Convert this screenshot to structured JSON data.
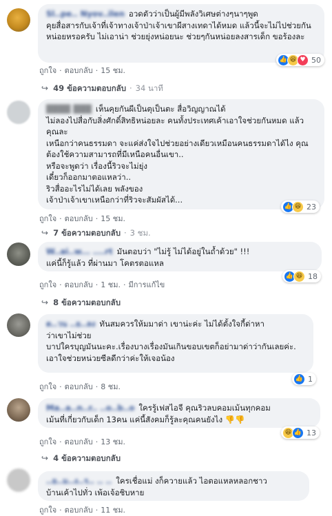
{
  "actions": {
    "like": "ถูกใจ",
    "reply": "ตอบกลับ",
    "sep": "·"
  },
  "comments": [
    {
      "author": "Sl..pe.. Nyov..ilen",
      "text_line1": "อวดตัวว่าเป็นผู้มีพลังวิเศษต่างๆนาๆพูด",
      "text_rest": "คุยสื่อสารกับเจ้าที่เจ้าทางเจ้าป่าเจ้าเขาผีสางเทดาได้หมด แล้วนี้จะไม่ไปช่วยกันหน่อยหรอครับ ไม่เอาน่า ช่วยยุ่งหน่อยนะ ช่วยๆกันหน่อยลงสารเด็ก ขอร้องละ",
      "time": "15 ชม.",
      "reaction_count": "50",
      "replies_count": "49 ข้อความตอบกลับ",
      "replies_time": "34 นาที"
    },
    {
      "author": "████ ███",
      "text_line1": "เห็นคุยกันผีเป็นตุเป็นตะ สื่อวิญญาณได้",
      "text_rest": "ไม่ลองไปสื่อกับสิ่งศักดิ์สิทธิหน่อยละ คนทั้งประเทศเค้าเอาใจช่วยกันหมด แล้วคุณละ\nเหนือกว่าคนธรรมดา จะแค่ส่งใจไปช่วยอย่างเดียวเหมือนคนธรรมดาได้ไง คุณต้องใช้ความสามารถที่มีเหนือคนอื่นเขา..\nหรือจะพูดว่า เรื่องนี้ริวจะไม่ยุ่ง\nเดี๋ยวก็ออกมาตอแหลว่า..\nริวสื่ออะไรไม่ได้เลย พลังของ\nเจ้าป่าเจ้าเขาเหนือกว่าที่ริวจะสัมผัสได้...",
      "time": "15 ชม.",
      "reaction_count": "23",
      "replies_count": "7 ข้อความตอบกลับ",
      "replies_time": "3 ชม."
    },
    {
      "author": "W..ai..w... ....rt",
      "text_line1": "มันตอบว่า \"ไม่รู้ ไม่ได้อยู่ในถ้ำด้วย\" !!!",
      "text_rest": "แค่นี้ก็รู้แล้ว ที่ผ่านมา โคตรตอแหล",
      "time": "1 ชม.",
      "edited": "มีการแก้ไข",
      "reaction_count": "18",
      "replies_count": "8 ข้อความตอบกลับ",
      "replies_time": ""
    },
    {
      "author": "ต..วน ..ย..ลง",
      "text_line1": "ทันสมควรให้มมาด่า เขาน่ะค่ะ ไม่ได้ตั้งใจกี้ด่าหา",
      "text_rest": "ว่าเขาไม่ช่วย\nบาปใครบุญมันนะคะ.เรื่องบางเรื่องมันเกินขอบเขตก็อย่ามาด่าว่ากันเลยค่ะ.\nเอาใจช่วยหน่วยซีลดีกว่าค่ะให้เจอน้อง",
      "time": "8 ชม.",
      "reaction_count": "1",
      "replies_count": "",
      "replies_time": ""
    },
    {
      "author": "Ma..a..n..r.. ..o..b..o",
      "text_line1": "ใครรู้เฟสไอจี คุณริวลบคอมเม้นทุกคอม",
      "text_rest": "เม้นที่เกี่ยวกับเด็ก 13คน แค่นี้สังคมก็รู้ละคุณคนยังไง 👎👎",
      "time": "13 ชม.",
      "reaction_count": "13",
      "replies_count": "4 ข้อความตอบกลับ",
      "replies_time": ""
    },
    {
      "author": "..ย..ม..ง..ร.. .. ..",
      "text_line1": "ใครเชื่อแม่ งก็ควายแล้ว ไอตอแหลหลอกชาว",
      "text_rest": "บ้านเค้าไปทั่ว เพ้อเจ้อชิบหาย",
      "time": "11 ชม.",
      "reaction_count": "",
      "replies_count": "",
      "replies_time": ""
    }
  ],
  "colors": {
    "like": "#1877f2",
    "haha": "#f7c948",
    "love": "#f33e58",
    "bubble": "#f0f2f5",
    "name": "#385898"
  }
}
